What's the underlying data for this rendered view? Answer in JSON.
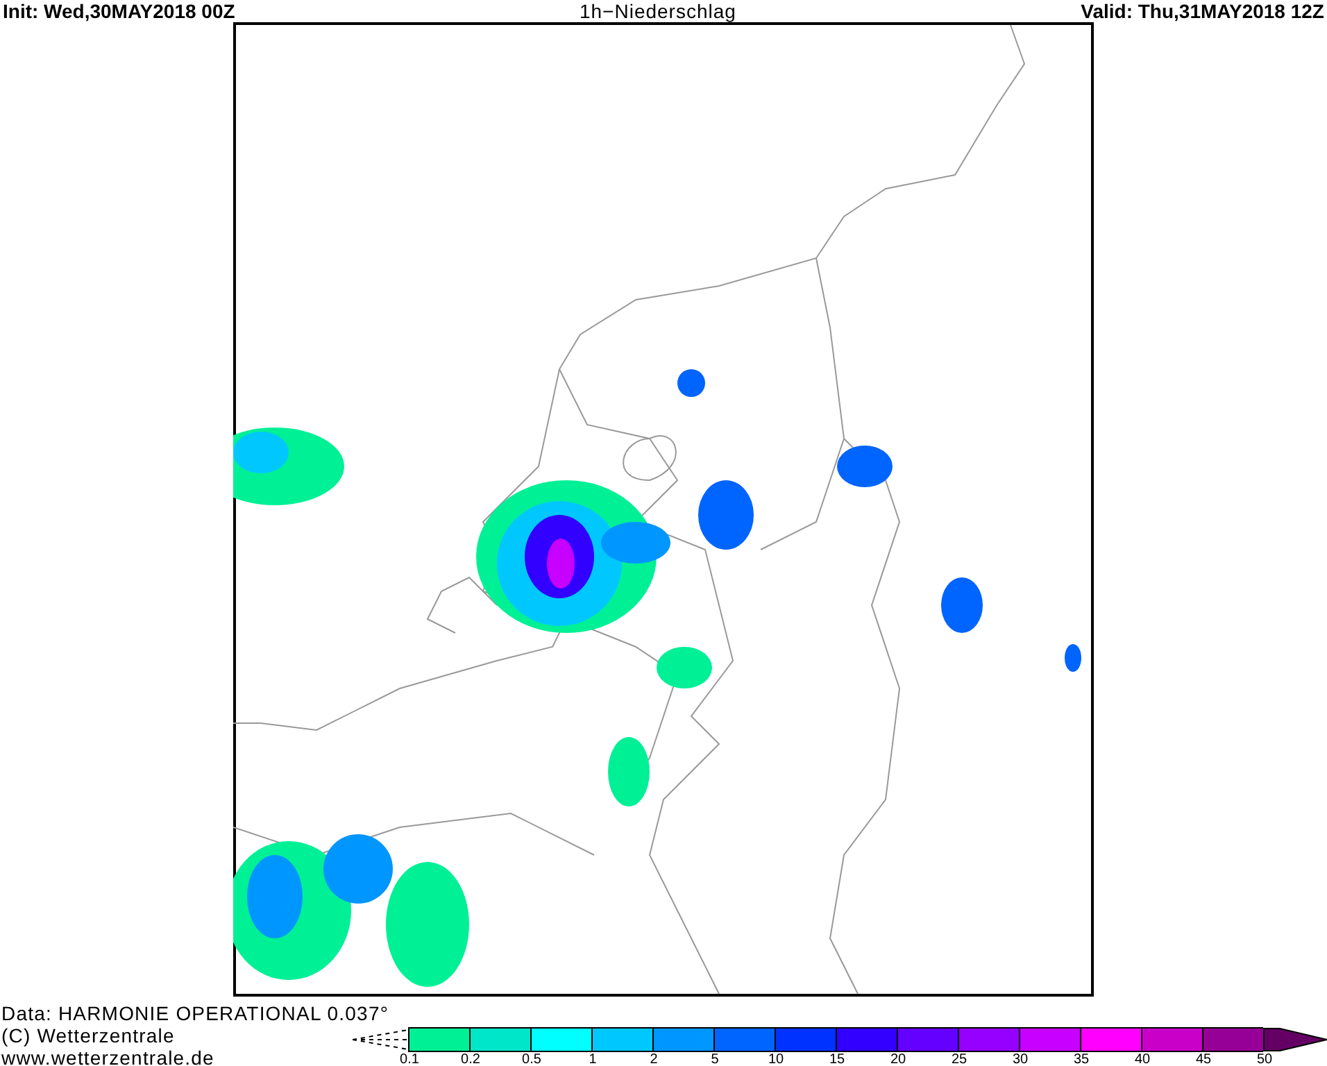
{
  "header": {
    "init": "Init: Wed,30MAY2018 00Z",
    "title": "1h−Niederschlag",
    "valid": "Valid: Thu,31MAY2018 12Z"
  },
  "footer": {
    "lines": [
      "Data: HARMONIE OPERATIONAL 0.037°",
      "(C) Wetterzentrale",
      "www.wetterzentrale.de"
    ]
  },
  "legend": {
    "bins": [
      {
        "color": "#00f096"
      },
      {
        "color": "#00e6c8"
      },
      {
        "color": "#00ffff"
      },
      {
        "color": "#00c8ff"
      },
      {
        "color": "#0096ff"
      },
      {
        "color": "#0064ff"
      },
      {
        "color": "#0032ff"
      },
      {
        "color": "#3200ff"
      },
      {
        "color": "#6400ff"
      },
      {
        "color": "#9600ff"
      },
      {
        "color": "#c800ff"
      },
      {
        "color": "#ff00ff"
      },
      {
        "color": "#c800c8"
      },
      {
        "color": "#960096"
      },
      {
        "color": "#640064",
        "kind": "arrow"
      }
    ],
    "ticks": [
      "0.1",
      "0.2",
      "0.5",
      "1",
      "2",
      "5",
      "10",
      "15",
      "20",
      "25",
      "30",
      "35",
      "40",
      "45",
      "50"
    ]
  }
}
